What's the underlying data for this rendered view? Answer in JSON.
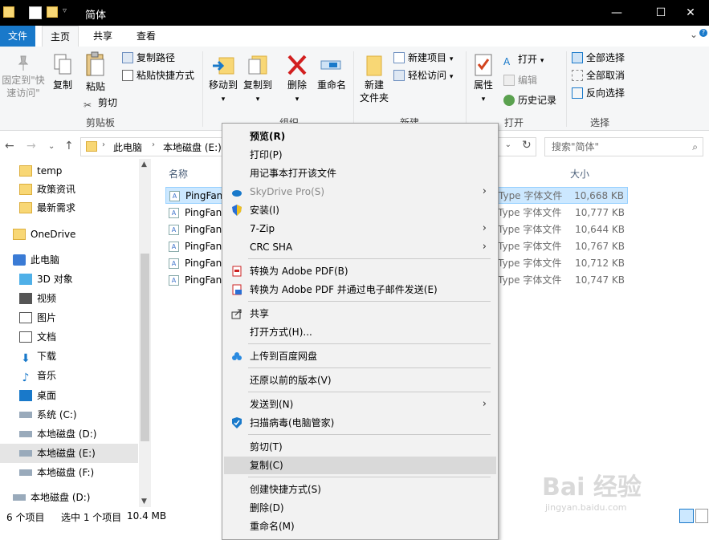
{
  "window": {
    "title": "简体",
    "controls": {
      "minimize": "—",
      "maximize": "☐",
      "close": "✕"
    }
  },
  "ribbon_tabs": [
    "文件",
    "主页",
    "共享",
    "查看"
  ],
  "ribbon": {
    "clipboard": {
      "pin_label_1": "固定到\"快",
      "pin_label_2": "速访问\"",
      "copy": "复制",
      "paste": "粘贴",
      "copy_path": "复制路径",
      "paste_shortcut": "粘贴快捷方式",
      "cut": "剪切",
      "group": "剪贴板"
    },
    "organize": {
      "move_to": "移动到",
      "copy_to": "复制到",
      "delete": "删除",
      "rename": "重命名",
      "group": "组织"
    },
    "new": {
      "new_folder_1": "新建",
      "new_folder_2": "文件夹",
      "new_item": "新建项目",
      "easy_access": "轻松访问",
      "group": "新建"
    },
    "open": {
      "properties": "属性",
      "open": "打开",
      "edit": "编辑",
      "history": "历史记录",
      "group": "打开"
    },
    "select": {
      "select_all": "全部选择",
      "select_none": "全部取消",
      "invert": "反向选择",
      "group": "选择"
    }
  },
  "address": {
    "path": [
      "此电脑",
      "本地磁盘 (E:)"
    ],
    "search_placeholder": "搜索\"简体\""
  },
  "nav_pane": {
    "items": [
      {
        "label": "temp",
        "icon": "folder-icon"
      },
      {
        "label": "政策资讯",
        "icon": "folder-icon"
      },
      {
        "label": "最新需求",
        "icon": "folder-icon"
      },
      {
        "label": "OneDrive",
        "icon": "onedrive-icon"
      },
      {
        "label": "此电脑",
        "icon": "computer-icon"
      },
      {
        "label": "3D 对象",
        "icon": "3d-objects-icon"
      },
      {
        "label": "视频",
        "icon": "video-icon"
      },
      {
        "label": "图片",
        "icon": "pictures-icon"
      },
      {
        "label": "文档",
        "icon": "documents-icon"
      },
      {
        "label": "下载",
        "icon": "download-icon"
      },
      {
        "label": "音乐",
        "icon": "music-icon"
      },
      {
        "label": "桌面",
        "icon": "desktop-icon"
      },
      {
        "label": "系统 (C:)",
        "icon": "drive-icon"
      },
      {
        "label": "本地磁盘 (D:)",
        "icon": "drive-icon"
      },
      {
        "label": "本地磁盘 (E:)",
        "icon": "drive-icon"
      },
      {
        "label": "本地磁盘 (F:)",
        "icon": "drive-icon"
      },
      {
        "label": "本地磁盘 (D:)",
        "icon": "drive-icon"
      }
    ]
  },
  "file_list": {
    "columns": {
      "name": "名称",
      "size": "大小"
    },
    "files": [
      {
        "name": "PingFan",
        "type": "Type 字体文件",
        "size": "10,668 KB",
        "selected": true
      },
      {
        "name": "PingFan",
        "type": "Type 字体文件",
        "size": "10,777 KB",
        "selected": false
      },
      {
        "name": "PingFan",
        "type": "Type 字体文件",
        "size": "10,644 KB",
        "selected": false
      },
      {
        "name": "PingFan",
        "type": "Type 字体文件",
        "size": "10,767 KB",
        "selected": false
      },
      {
        "name": "PingFan",
        "type": "Type 字体文件",
        "size": "10,712 KB",
        "selected": false
      },
      {
        "name": "PingFan",
        "type": "Type 字体文件",
        "size": "10,747 KB",
        "selected": false
      }
    ]
  },
  "status_bar": {
    "count": "6 个项目",
    "selection": "选中 1 个项目",
    "size": "10.4 MB"
  },
  "context_menu": {
    "items": [
      {
        "label": "预览(R)",
        "bold": true
      },
      {
        "label": "打印(P)"
      },
      {
        "label": "用记事本打开该文件"
      },
      {
        "label": "SkyDrive Pro(S)",
        "disabled": true,
        "submenu": true,
        "icon": "skydrive-icon"
      },
      {
        "label": "安装(I)",
        "icon": "shield-icon"
      },
      {
        "label": "7-Zip",
        "submenu": true
      },
      {
        "label": "CRC SHA",
        "submenu": true
      },
      {
        "label": "转换为 Adobe PDF(B)",
        "icon": "pdf-icon"
      },
      {
        "label": "转换为 Adobe PDF 并通过电子邮件发送(E)",
        "icon": "pdf-mail-icon"
      },
      {
        "label": "共享",
        "icon": "share-icon"
      },
      {
        "label": "打开方式(H)..."
      },
      {
        "label": "上传到百度网盘",
        "icon": "baidu-cloud-icon"
      },
      {
        "label": "还原以前的版本(V)"
      },
      {
        "label": "发送到(N)",
        "submenu": true
      },
      {
        "label": "扫描病毒(电脑管家)",
        "icon": "antivirus-icon"
      },
      {
        "label": "剪切(T)"
      },
      {
        "label": "复制(C)",
        "hover": true
      },
      {
        "label": "创建快捷方式(S)"
      },
      {
        "label": "删除(D)"
      },
      {
        "label": "重命名(M)"
      }
    ]
  },
  "watermark": {
    "text_main": "Bai 经验",
    "text_sub": "jingyan.baidu.com"
  },
  "colors": {
    "accent": "#1979ca",
    "selection": "#cce8ff",
    "menu_bg": "#f2f2f2"
  }
}
